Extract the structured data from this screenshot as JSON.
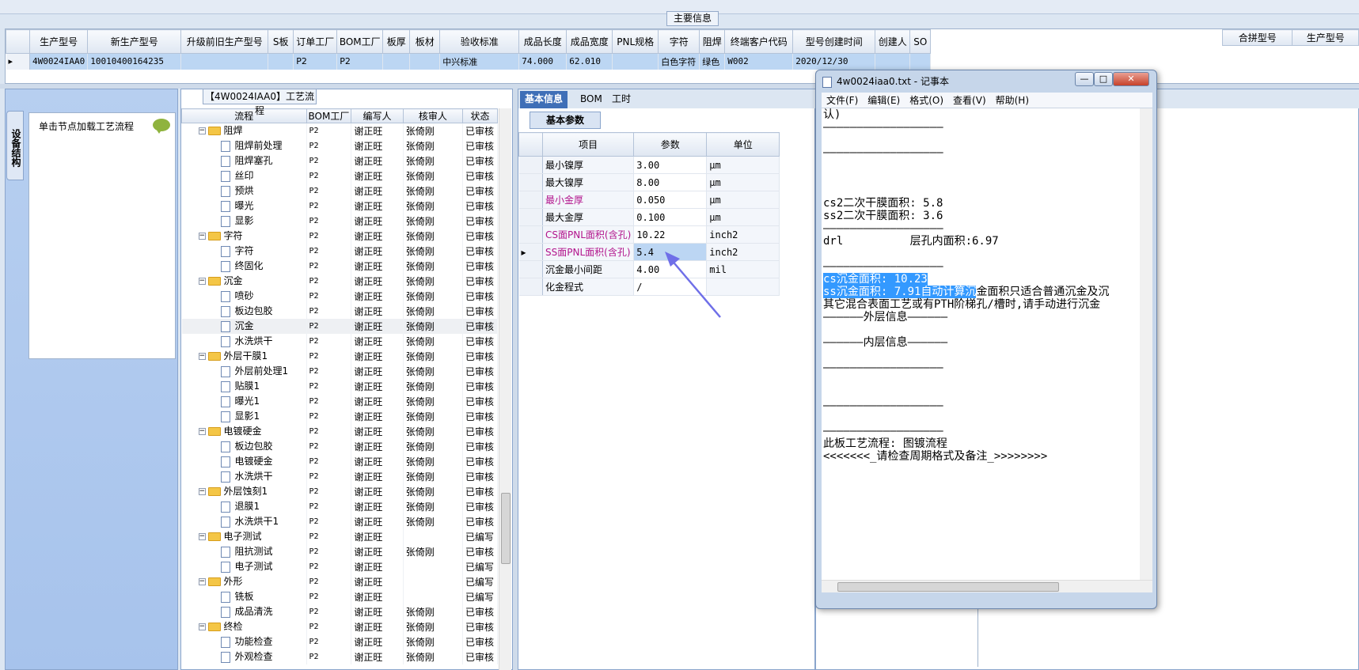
{
  "main_info": {
    "title": "主要信息",
    "columns": [
      "生产型号",
      "新生产型号",
      "升级前旧生产型号",
      "S板",
      "订单工厂",
      "BOM工厂",
      "板厚",
      "板材",
      "验收标准",
      "成品长度",
      "成品宽度",
      "PNL规格",
      "字符",
      "阻焊",
      "终端客户代码",
      "型号创建时间",
      "创建人",
      "SO"
    ],
    "row": [
      "4W0024IAA0",
      "10010400164235",
      "",
      "",
      "P2",
      "P2",
      "",
      "",
      "中兴标准",
      "74.000",
      "62.010",
      "",
      "白色字符",
      "绿色",
      "W002",
      "2020/12/30",
      "",
      ""
    ],
    "merge_columns": [
      "合拼型号",
      "生产型号"
    ]
  },
  "left_panel": {
    "vertical_tab": "设备结构",
    "hint": "单击节点加载工艺流程"
  },
  "process": {
    "title": "【4W0024IAA0】工艺流程",
    "columns": [
      "流程",
      "BOM工厂",
      "编写人",
      "核审人",
      "状态"
    ],
    "rows": [
      {
        "level": 0,
        "name": "阻焊",
        "bom": "P2",
        "writer": "谢正旺",
        "reviewer": "张倚刚",
        "status": "已审核"
      },
      {
        "level": 1,
        "name": "阻焊前处理",
        "bom": "P2",
        "writer": "谢正旺",
        "reviewer": "张倚刚",
        "status": "已审核"
      },
      {
        "level": 1,
        "name": "阻焊塞孔",
        "bom": "P2",
        "writer": "谢正旺",
        "reviewer": "张倚刚",
        "status": "已审核"
      },
      {
        "level": 1,
        "name": "丝印",
        "bom": "P2",
        "writer": "谢正旺",
        "reviewer": "张倚刚",
        "status": "已审核"
      },
      {
        "level": 1,
        "name": "预烘",
        "bom": "P2",
        "writer": "谢正旺",
        "reviewer": "张倚刚",
        "status": "已审核"
      },
      {
        "level": 1,
        "name": "曝光",
        "bom": "P2",
        "writer": "谢正旺",
        "reviewer": "张倚刚",
        "status": "已审核"
      },
      {
        "level": 1,
        "name": "显影",
        "bom": "P2",
        "writer": "谢正旺",
        "reviewer": "张倚刚",
        "status": "已审核"
      },
      {
        "level": 0,
        "name": "字符",
        "bom": "P2",
        "writer": "谢正旺",
        "reviewer": "张倚刚",
        "status": "已审核"
      },
      {
        "level": 1,
        "name": "字符",
        "bom": "P2",
        "writer": "谢正旺",
        "reviewer": "张倚刚",
        "status": "已审核"
      },
      {
        "level": 1,
        "name": "终固化",
        "bom": "P2",
        "writer": "谢正旺",
        "reviewer": "张倚刚",
        "status": "已审核"
      },
      {
        "level": 0,
        "name": "沉金",
        "bom": "P2",
        "writer": "谢正旺",
        "reviewer": "张倚刚",
        "status": "已审核"
      },
      {
        "level": 1,
        "name": "喷砂",
        "bom": "P2",
        "writer": "谢正旺",
        "reviewer": "张倚刚",
        "status": "已审核"
      },
      {
        "level": 1,
        "name": "板边包胶",
        "bom": "P2",
        "writer": "谢正旺",
        "reviewer": "张倚刚",
        "status": "已审核"
      },
      {
        "level": 1,
        "name": "沉金",
        "bom": "P2",
        "writer": "谢正旺",
        "reviewer": "张倚刚",
        "status": "已审核",
        "hl": true
      },
      {
        "level": 1,
        "name": "水洗烘干",
        "bom": "P2",
        "writer": "谢正旺",
        "reviewer": "张倚刚",
        "status": "已审核"
      },
      {
        "level": 0,
        "name": "外层干膜1",
        "bom": "P2",
        "writer": "谢正旺",
        "reviewer": "张倚刚",
        "status": "已审核"
      },
      {
        "level": 1,
        "name": "外层前处理1",
        "bom": "P2",
        "writer": "谢正旺",
        "reviewer": "张倚刚",
        "status": "已审核"
      },
      {
        "level": 1,
        "name": "贴膜1",
        "bom": "P2",
        "writer": "谢正旺",
        "reviewer": "张倚刚",
        "status": "已审核"
      },
      {
        "level": 1,
        "name": "曝光1",
        "bom": "P2",
        "writer": "谢正旺",
        "reviewer": "张倚刚",
        "status": "已审核"
      },
      {
        "level": 1,
        "name": "显影1",
        "bom": "P2",
        "writer": "谢正旺",
        "reviewer": "张倚刚",
        "status": "已审核"
      },
      {
        "level": 0,
        "name": "电镀硬金",
        "bom": "P2",
        "writer": "谢正旺",
        "reviewer": "张倚刚",
        "status": "已审核"
      },
      {
        "level": 1,
        "name": "板边包胶",
        "bom": "P2",
        "writer": "谢正旺",
        "reviewer": "张倚刚",
        "status": "已审核"
      },
      {
        "level": 1,
        "name": "电镀硬金",
        "bom": "P2",
        "writer": "谢正旺",
        "reviewer": "张倚刚",
        "status": "已审核"
      },
      {
        "level": 1,
        "name": "水洗烘干",
        "bom": "P2",
        "writer": "谢正旺",
        "reviewer": "张倚刚",
        "status": "已审核"
      },
      {
        "level": 0,
        "name": "外层蚀刻1",
        "bom": "P2",
        "writer": "谢正旺",
        "reviewer": "张倚刚",
        "status": "已审核"
      },
      {
        "level": 1,
        "name": "退膜1",
        "bom": "P2",
        "writer": "谢正旺",
        "reviewer": "张倚刚",
        "status": "已审核"
      },
      {
        "level": 1,
        "name": "水洗烘干1",
        "bom": "P2",
        "writer": "谢正旺",
        "reviewer": "张倚刚",
        "status": "已审核"
      },
      {
        "level": 0,
        "name": "电子测试",
        "bom": "P2",
        "writer": "谢正旺",
        "reviewer": "",
        "status": "已编写"
      },
      {
        "level": 1,
        "name": "阻抗测试",
        "bom": "P2",
        "writer": "谢正旺",
        "reviewer": "张倚刚",
        "status": "已审核"
      },
      {
        "level": 1,
        "name": "电子测试",
        "bom": "P2",
        "writer": "谢正旺",
        "reviewer": "",
        "status": "已编写"
      },
      {
        "level": 0,
        "name": "外形",
        "bom": "P2",
        "writer": "谢正旺",
        "reviewer": "",
        "status": "已编写"
      },
      {
        "level": 1,
        "name": "铣板",
        "bom": "P2",
        "writer": "谢正旺",
        "reviewer": "",
        "status": "已编写"
      },
      {
        "level": 1,
        "name": "成品清洗",
        "bom": "P2",
        "writer": "谢正旺",
        "reviewer": "张倚刚",
        "status": "已审核"
      },
      {
        "level": 0,
        "name": "终检",
        "bom": "P2",
        "writer": "谢正旺",
        "reviewer": "张倚刚",
        "status": "已审核"
      },
      {
        "level": 1,
        "name": "功能检查",
        "bom": "P2",
        "writer": "谢正旺",
        "reviewer": "张倚刚",
        "status": "已审核"
      },
      {
        "level": 1,
        "name": "外观检查",
        "bom": "P2",
        "writer": "谢正旺",
        "reviewer": "张倚刚",
        "status": "已审核"
      }
    ]
  },
  "info": {
    "tabs": [
      "基本信息",
      "BOM",
      "工时"
    ],
    "subtab": "基本参数",
    "columns": [
      "项目",
      "参数",
      "单位"
    ],
    "rows": [
      {
        "item": "最小镍厚",
        "value": "3.00",
        "unit": "μm",
        "pink": false
      },
      {
        "item": "最大镍厚",
        "value": "8.00",
        "unit": "μm",
        "pink": false
      },
      {
        "item": "最小金厚",
        "value": "0.050",
        "unit": "μm",
        "pink": true
      },
      {
        "item": "最大金厚",
        "value": "0.100",
        "unit": "μm",
        "pink": false
      },
      {
        "item": "CS面PNL面积(含孔)",
        "value": "10.22",
        "unit": "inch2",
        "pink": true
      },
      {
        "item": "SS面PNL面积(含孔)",
        "value": "5.4",
        "unit": "inch2",
        "pink": true,
        "sel": true
      },
      {
        "item": "沉金最小间距",
        "value": "4.00",
        "unit": "mil",
        "pink": false
      },
      {
        "item": "化金程式",
        "value": "/",
        "unit": "",
        "pink": false
      }
    ]
  },
  "notepad": {
    "title": "4w0024iaa0.txt - 记事本",
    "menu": [
      "文件(F)",
      "编辑(E)",
      "格式(O)",
      "查看(V)",
      "帮助(H)"
    ],
    "lines": [
      {
        "t": "认)"
      },
      {
        "t": "——————————————————"
      },
      {
        "t": ""
      },
      {
        "t": "——————————————————"
      },
      {
        "t": ""
      },
      {
        "t": ""
      },
      {
        "t": ""
      },
      {
        "t": "cs2二次干膜面积: 5.8"
      },
      {
        "t": "ss2二次干膜面积: 3.6"
      },
      {
        "t": "——————————————————"
      },
      {
        "t": "drl          层孔内面积:6.97"
      },
      {
        "t": ""
      },
      {
        "t": "——————————————————"
      },
      {
        "t": "",
        "sel": "cs沉金面积: 10.23"
      },
      {
        "t": "金面积只适合普通沉金及沉",
        "sel": "ss沉金面积: 7.91自动计算沉"
      },
      {
        "t": "其它混合表面工艺或有PTH阶梯孔/槽时,请手动进行沉金"
      },
      {
        "t": "——————外层信息——————"
      },
      {
        "t": ""
      },
      {
        "t": "——————内层信息——————"
      },
      {
        "t": ""
      },
      {
        "t": "——————————————————"
      },
      {
        "t": ""
      },
      {
        "t": ""
      },
      {
        "t": "——————————————————"
      },
      {
        "t": ""
      },
      {
        "t": "——————————————————"
      },
      {
        "t": "此板工艺流程: 图镀流程"
      },
      {
        "t": "<<<<<<<_请检查周期格式及备注_>>>>>>>>"
      }
    ]
  },
  "colors": {
    "accent": "#3f6fb7",
    "selection": "#bcd6f3",
    "pink": "#b2148c",
    "panel": "#dce6f2"
  }
}
